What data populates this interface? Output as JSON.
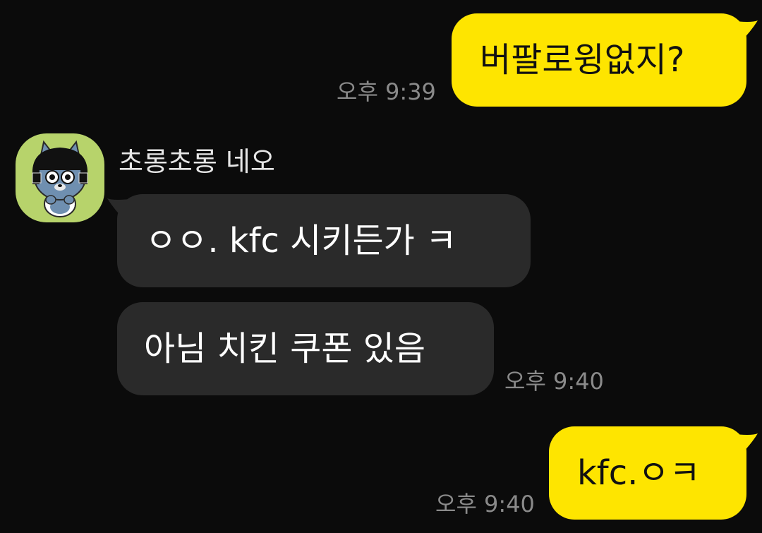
{
  "chat": {
    "accent_color": "#fee500",
    "other_bubble_color": "#2a2a2a",
    "background_color": "#0b0b0b",
    "messages": [
      {
        "from": "me",
        "text": "버팔로윙없지?",
        "time": "오후 9:39"
      },
      {
        "from": "other",
        "sender": "초롱초롱 네오",
        "avatar_icon": "neo-character-icon",
        "text": "ㅇㅇ. kfc 시키든가 ㅋ"
      },
      {
        "from": "other",
        "text": "아님 치킨 쿠폰 있음",
        "time": "오후 9:40"
      },
      {
        "from": "me",
        "text": "kfc.ㅇㅋ",
        "time": "오후 9:40"
      }
    ]
  }
}
